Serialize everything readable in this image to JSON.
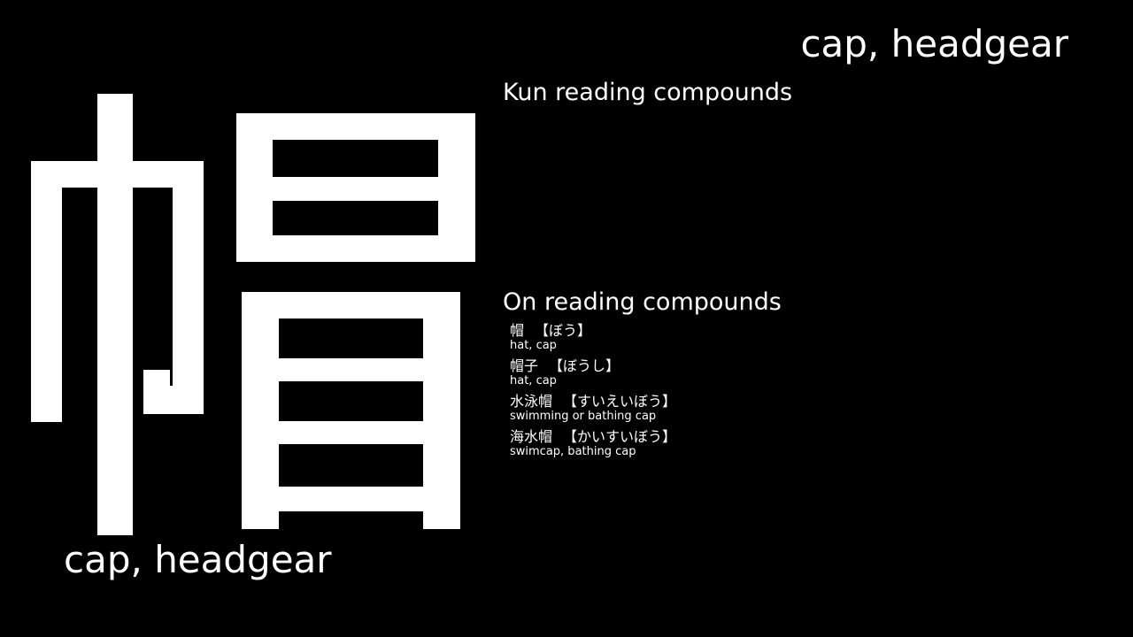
{
  "meaning_top": "cap, headgear",
  "kanji": {
    "character": "帽",
    "icon": "kanji-glyph"
  },
  "meaning_bottom": "cap, headgear",
  "kun_section": {
    "title": "Kun reading compounds",
    "items": []
  },
  "on_section": {
    "title": "On reading compounds",
    "items": [
      {
        "word": "帽",
        "reading": "【ぼう】",
        "meaning": "hat, cap"
      },
      {
        "word": "帽子",
        "reading": "【ぼうし】",
        "meaning": "hat, cap"
      },
      {
        "word": "水泳帽",
        "reading": "【すいえいぼう】",
        "meaning": "swimming or bathing cap"
      },
      {
        "word": "海水帽",
        "reading": "【かいすいぼう】",
        "meaning": "swimcap, bathing cap"
      }
    ]
  },
  "colors": {
    "background": "#000000",
    "text": "#ffffff"
  }
}
